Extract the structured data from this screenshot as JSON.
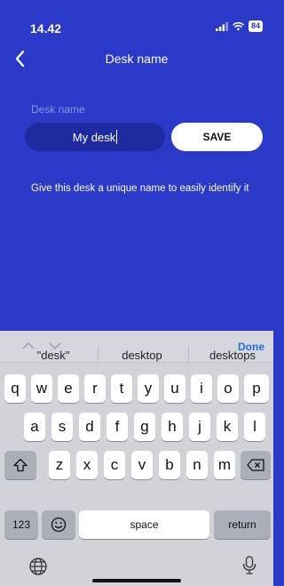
{
  "status_bar": {
    "time": "14.42",
    "signal_icon": "signal-bars-icon",
    "wifi_icon": "wifi-icon",
    "battery_level": "84"
  },
  "nav": {
    "back_icon": "chevron-left-icon",
    "title": "Desk name"
  },
  "form": {
    "label": "Desk name",
    "input_value": "My desk",
    "save_label": "SAVE",
    "hint": "Give this desk a unique name to easily identify it"
  },
  "keyboard": {
    "accessory": {
      "prev_icon": "chevron-up-icon",
      "next_icon": "chevron-down-icon",
      "done_label": "Done"
    },
    "predictions": [
      "\"desk\"",
      "desktop",
      "desktops"
    ],
    "rows": [
      [
        "q",
        "w",
        "e",
        "r",
        "t",
        "y",
        "u",
        "i",
        "o",
        "p"
      ],
      [
        "a",
        "s",
        "d",
        "f",
        "g",
        "h",
        "j",
        "k",
        "l"
      ],
      [
        "z",
        "x",
        "c",
        "v",
        "b",
        "n",
        "m"
      ]
    ],
    "numbers_label": "123",
    "space_label": "space",
    "return_label": "return",
    "shift_icon": "shift-icon",
    "delete_icon": "delete-icon",
    "emoji_icon": "emoji-icon",
    "globe_icon": "globe-icon",
    "mic_icon": "microphone-icon"
  }
}
